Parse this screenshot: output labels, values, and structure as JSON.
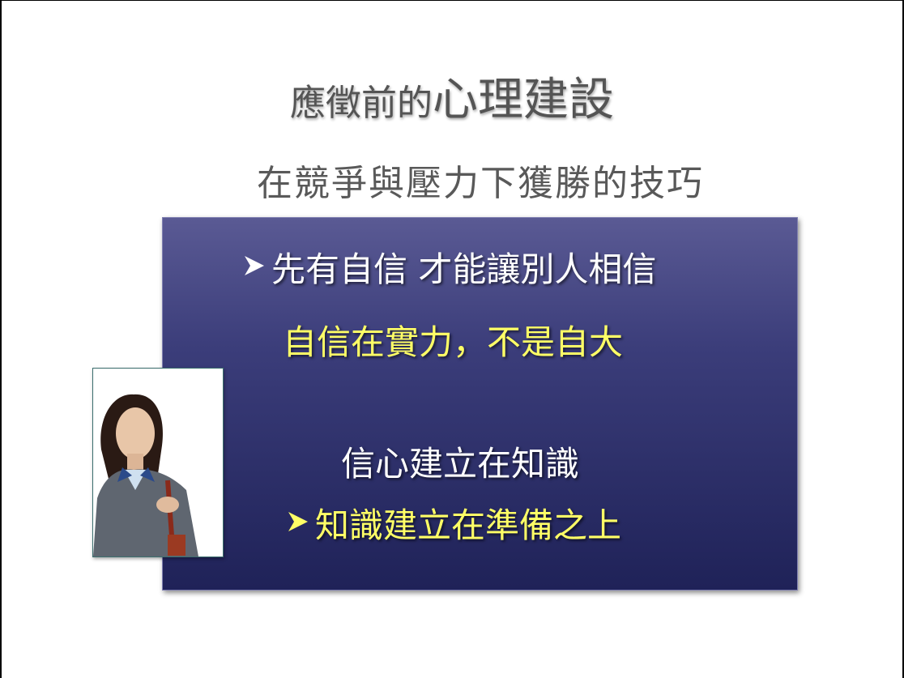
{
  "slide": {
    "title_small": "應徵前的",
    "title_large": "心理建設",
    "subtitle": "在競爭與壓力下獲勝的技巧",
    "panel": {
      "line1": "先有自信 才能讓別人相信",
      "line2": "自信在實力，不是自大",
      "line3": "信心建立在知識",
      "line4": "知識建立在準備之上"
    },
    "colors": {
      "title": "#555555",
      "panel_top": "#5a5a94",
      "panel_bottom": "#1f2258",
      "white_text": "#ffffff",
      "yellow_text": "#ffff66"
    },
    "icons": {
      "bullet": "arrow-bullet-icon",
      "photo": "businesswoman-photo"
    }
  }
}
